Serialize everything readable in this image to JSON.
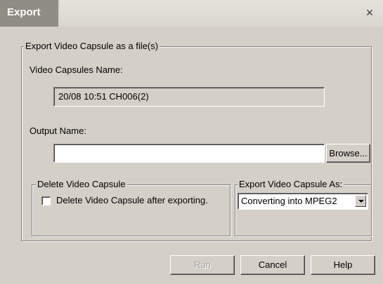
{
  "window": {
    "title": "Export",
    "close_glyph": "×"
  },
  "export_group": {
    "legend": "Export Video Capsule as a file(s)",
    "capsule_name_label": "Video Capsules Name:",
    "capsule_name_value": "20/08 10:51 CH006(2)",
    "output_name_label": "Output Name:",
    "output_name_value": "",
    "browse_label": "Browse..."
  },
  "delete_group": {
    "legend": "Delete Video Capsule",
    "checkbox_label": "Delete Video Capsule after exporting.",
    "checked": false
  },
  "format_group": {
    "legend": "Export Video Capsule As:",
    "selected": "Converting into MPEG2"
  },
  "buttons": {
    "run": "Run",
    "cancel": "Cancel",
    "help": "Help"
  },
  "icons": {
    "close": "close-icon",
    "dropdown": "chevron-down-icon"
  }
}
